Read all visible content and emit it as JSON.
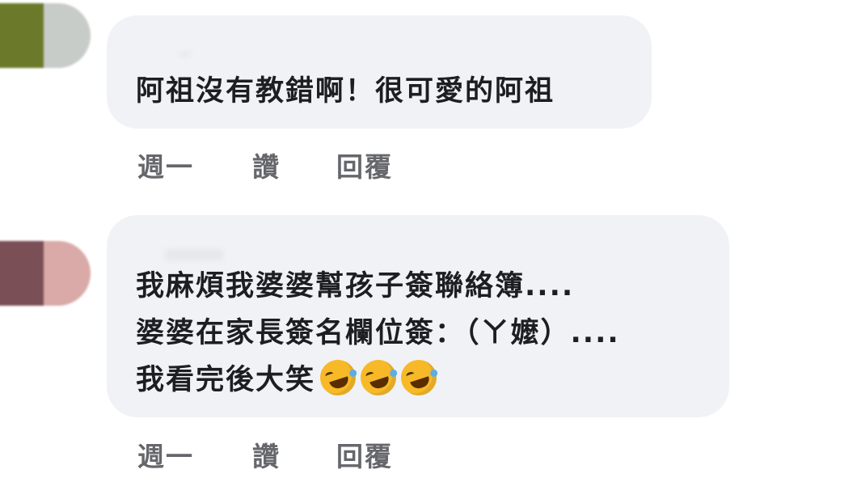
{
  "comments": [
    {
      "avatar_colors": [
        "#6b7a2a",
        "#c8ccc9"
      ],
      "lines": [
        "阿祖沒有教錯啊！很可愛的阿祖"
      ],
      "emoji": [],
      "actions": {
        "time": "週一",
        "like": "讚",
        "reply": "回覆"
      }
    },
    {
      "avatar_colors": [
        "#7a4f55",
        "#d9aaa8"
      ],
      "lines": [
        "我麻煩我婆婆幫孩子簽聯絡簿....",
        "婆婆在家長簽名欄位簽：（ㄚ嬤）....",
        "我看完後大笑"
      ],
      "emoji": [
        "rolling-on-floor-laughing",
        "rolling-on-floor-laughing",
        "rolling-on-floor-laughing"
      ],
      "actions": {
        "time": "週一",
        "like": "讚",
        "reply": "回覆"
      }
    }
  ],
  "colors": {
    "bubble": "#f0f2f5",
    "text": "#1c1e21",
    "action_text": "#65676b"
  }
}
